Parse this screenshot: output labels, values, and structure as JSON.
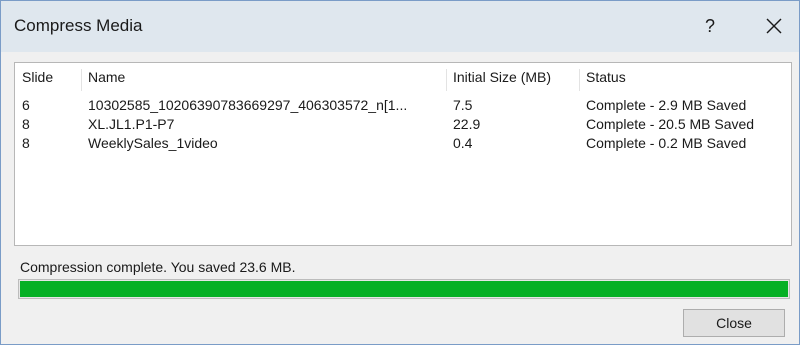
{
  "window": {
    "title": "Compress Media",
    "help_label": "?"
  },
  "table": {
    "columns": [
      "Slide",
      "Name",
      "Initial Size (MB)",
      "Status"
    ],
    "rows": [
      {
        "slide": "6",
        "name": "10302585_10206390783669297_406303572_n[1...",
        "size": "7.5",
        "status": "Complete - 2.9 MB Saved"
      },
      {
        "slide": "8",
        "name": "XL.JL1.P1-P7",
        "size": "22.9",
        "status": "Complete - 20.5 MB Saved"
      },
      {
        "slide": "8",
        "name": "WeeklySales_1video",
        "size": "0.4",
        "status": "Complete - 0.2 MB Saved"
      }
    ]
  },
  "status_message": "Compression complete. You saved 23.6 MB.",
  "progress": {
    "percent": 100,
    "color": "#06b025"
  },
  "buttons": {
    "close_label": "Close"
  },
  "icons": {
    "close_window": "close-icon"
  }
}
